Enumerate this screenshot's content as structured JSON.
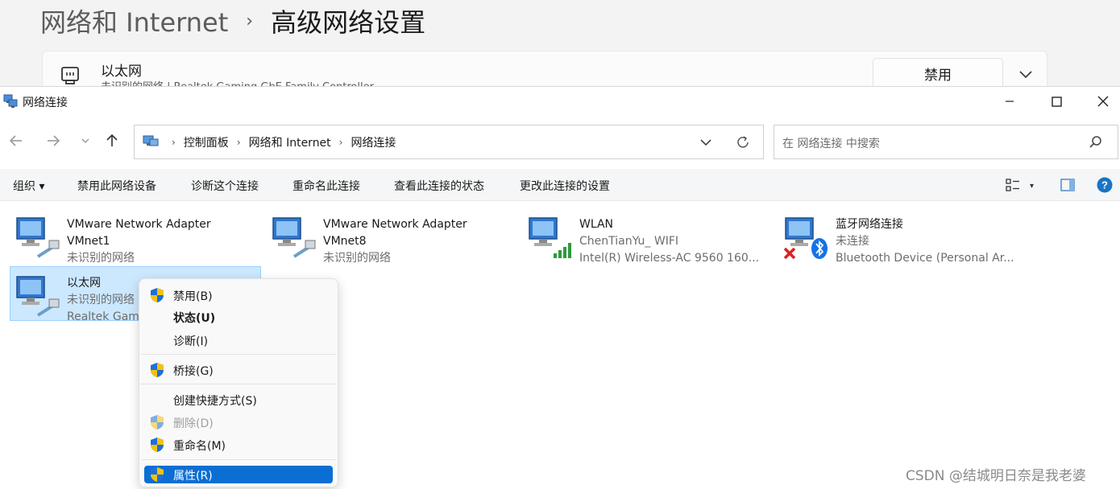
{
  "bg_settings": {
    "breadcrumb_parent": "网络和 Internet",
    "breadcrumb_separator": "›",
    "breadcrumb_current": "高级网络设置",
    "card_title": "以太网",
    "card_subtitle": "未识别的网络 | Realtek Gaming GbE Family Controller",
    "disable_button": "禁用"
  },
  "window": {
    "title": "网络连接",
    "controls": [
      "minimize",
      "maximize",
      "close"
    ]
  },
  "address_bar": {
    "crumbs": [
      "控制面板",
      "网络和 Internet",
      "网络连接"
    ],
    "separator": "›"
  },
  "search": {
    "placeholder": "在 网络连接 中搜索"
  },
  "toolbar": {
    "organize": "组织 ▾",
    "disable_device": "禁用此网络设备",
    "diagnose": "诊断这个连接",
    "rename": "重命名此连接",
    "view_status": "查看此连接的状态",
    "change_settings": "更改此连接的设置",
    "view_arrow": "▾",
    "help": "?"
  },
  "connections": [
    {
      "name": "VMware Network Adapter",
      "line2": "VMnet1",
      "line3": "未识别的网络",
      "icon": "ethernet-icon"
    },
    {
      "name": "VMware Network Adapter",
      "line2": "VMnet8",
      "line3": "未识别的网络",
      "icon": "ethernet-icon"
    },
    {
      "name": "WLAN",
      "line2": "ChenTianYu_ WIFI",
      "line3": "Intel(R) Wireless-AC 9560 160...",
      "icon": "wifi-icon"
    },
    {
      "name": "蓝牙网络连接",
      "line2": "未连接",
      "line3": "Bluetooth Device (Personal Ar...",
      "icon": "bluetooth-icon"
    },
    {
      "name": "以太网",
      "line2": "未识别的网络",
      "line3": "Realtek Gam",
      "icon": "ethernet-icon",
      "selected": true
    }
  ],
  "context_menu": {
    "items": [
      {
        "label": "禁用(B)",
        "shield": true
      },
      {
        "label": "状态(U)",
        "bold": true
      },
      {
        "label": "诊断(I)"
      },
      {
        "label": "桥接(G)",
        "shield": true
      },
      {
        "label": "创建快捷方式(S)"
      },
      {
        "label": "删除(D)",
        "shield": true,
        "disabled": true
      },
      {
        "label": "重命名(M)",
        "shield": true
      },
      {
        "label": "属性(R)",
        "shield": true,
        "highlighted": true
      }
    ]
  },
  "watermark": "CSDN @结城明日奈是我老婆",
  "colors": {
    "selection_bg": "#cce8ff",
    "menu_highlight": "#0b6ed3",
    "help_blue": "#1a73c7"
  }
}
